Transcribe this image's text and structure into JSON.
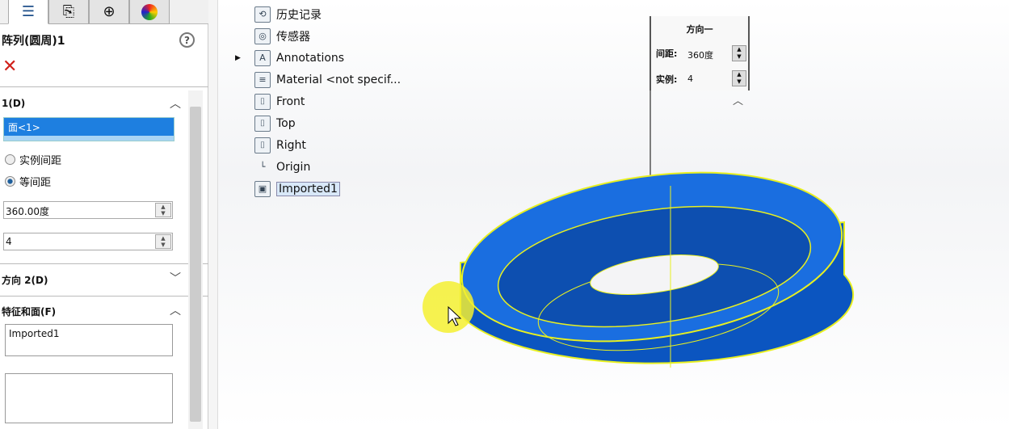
{
  "panel": {
    "tabs": [
      {
        "icon": "feature-manager-icon"
      },
      {
        "icon": "property-manager-icon"
      },
      {
        "icon": "configuration-manager-icon"
      },
      {
        "icon": "display-manager-icon"
      }
    ],
    "title": "阵列(圆周)1",
    "help": "?",
    "close": "✕",
    "direction1": {
      "label": "1(D)",
      "selection": "面<1>",
      "option1": "实例间距",
      "option2": "等间距",
      "selected": "等间距",
      "angle": "360.00度",
      "count": "4"
    },
    "direction2": {
      "label": "方向 2(D)"
    },
    "features": {
      "label": "特征和面(F)",
      "item": "Imported1"
    }
  },
  "tree": {
    "items": [
      {
        "label": "历史记录",
        "icon": "history-icon"
      },
      {
        "label": "传感器",
        "icon": "sensor-icon"
      },
      {
        "label": "Annotations",
        "icon": "annotations-icon"
      },
      {
        "label": "Material <not specif...",
        "icon": "material-icon"
      },
      {
        "label": "Front",
        "icon": "plane-icon"
      },
      {
        "label": "Top",
        "icon": "plane-icon"
      },
      {
        "label": "Right",
        "icon": "plane-icon"
      },
      {
        "label": "Origin",
        "icon": "origin-icon"
      },
      {
        "label": "Imported1",
        "icon": "part-icon"
      }
    ]
  },
  "callout": {
    "header": "方向一",
    "spacing_label": "间距:",
    "spacing_value": "360度",
    "count_label": "实例:",
    "count_value": "4"
  },
  "colors": {
    "model": "#0a5fd0",
    "edge": "#e8f020",
    "selection": "#1e7fe0"
  }
}
